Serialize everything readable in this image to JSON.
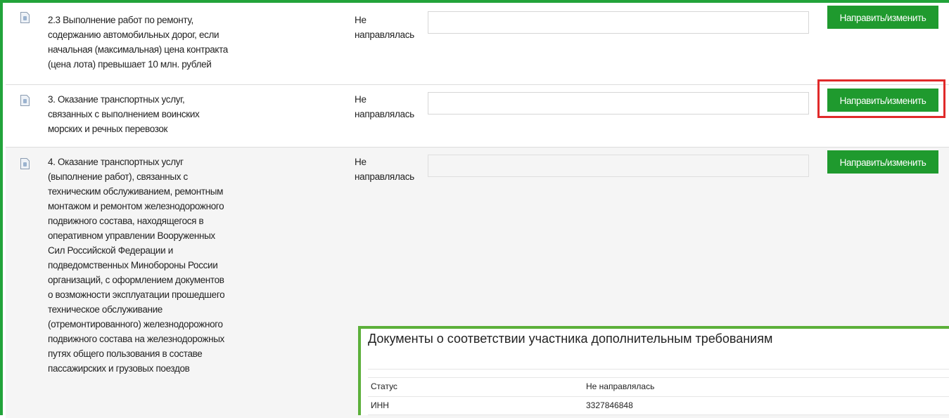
{
  "requirements": [
    {
      "text": "2.3 Выполнение работ по ремонту, содержанию автомобильных дорог, если начальная (максимальная) цена контракта (цена лота) превышает 10 млн. рублей",
      "status": "Не направлялась",
      "button_label": "Направить/изменить"
    },
    {
      "text": "3. Оказание транспортных услуг, связанных с выполнением воинских морских и речных перевозок",
      "status": "Не направлялась",
      "button_label": "Направить/изменить"
    },
    {
      "text": "4. Оказание транспортных услуг (выполнение работ), связанных с техническим обслуживанием, ремонтным монтажом и ремонтом железнодорожного подвижного состава, находящегося в оперативном управлении Вооруженных Сил Российской Федерации и подведомственных Минобороны России организаций, с оформлением документов о возможности эксплуатации прошедшего техническое обслуживание (отремонтированного) железнодорожного подвижного состава на железнодорожных путях общего пользования в составе пассажирских и грузовых поездов",
      "status": "Не направлялась",
      "button_label": "Направить/изменить"
    }
  ],
  "popup": {
    "title": "Документы о соответствии участника дополнительным требованиям",
    "fields": [
      {
        "label": "Статус",
        "value": "Не направлялась"
      },
      {
        "label": "ИНН",
        "value": "3327846848"
      }
    ]
  },
  "icons": {
    "document": "document-icon"
  },
  "colors": {
    "button_green": "#1f9a2e",
    "frame_green": "#22a33a",
    "highlight_red": "#e02a2a"
  }
}
